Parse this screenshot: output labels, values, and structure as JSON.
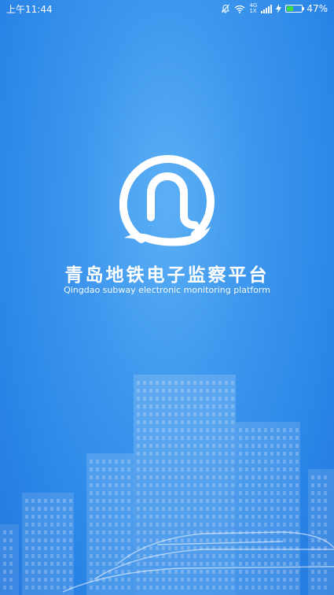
{
  "status_bar": {
    "time": "上午11:44",
    "network_top": "4G",
    "network_bottom": "1X",
    "battery_percent": "47%",
    "battery_level": 0.47,
    "icons": [
      "mute-icon",
      "wifi-icon",
      "signal-icon",
      "charging-icon",
      "battery-icon"
    ]
  },
  "splash": {
    "title": "青岛地铁电子监察平台",
    "subtitle": "Qingdao subway electronic monitoring platform"
  },
  "colors": {
    "background": "#2a85e6",
    "battery_fill": "#3ddb3d",
    "logo": "#ffffff"
  }
}
